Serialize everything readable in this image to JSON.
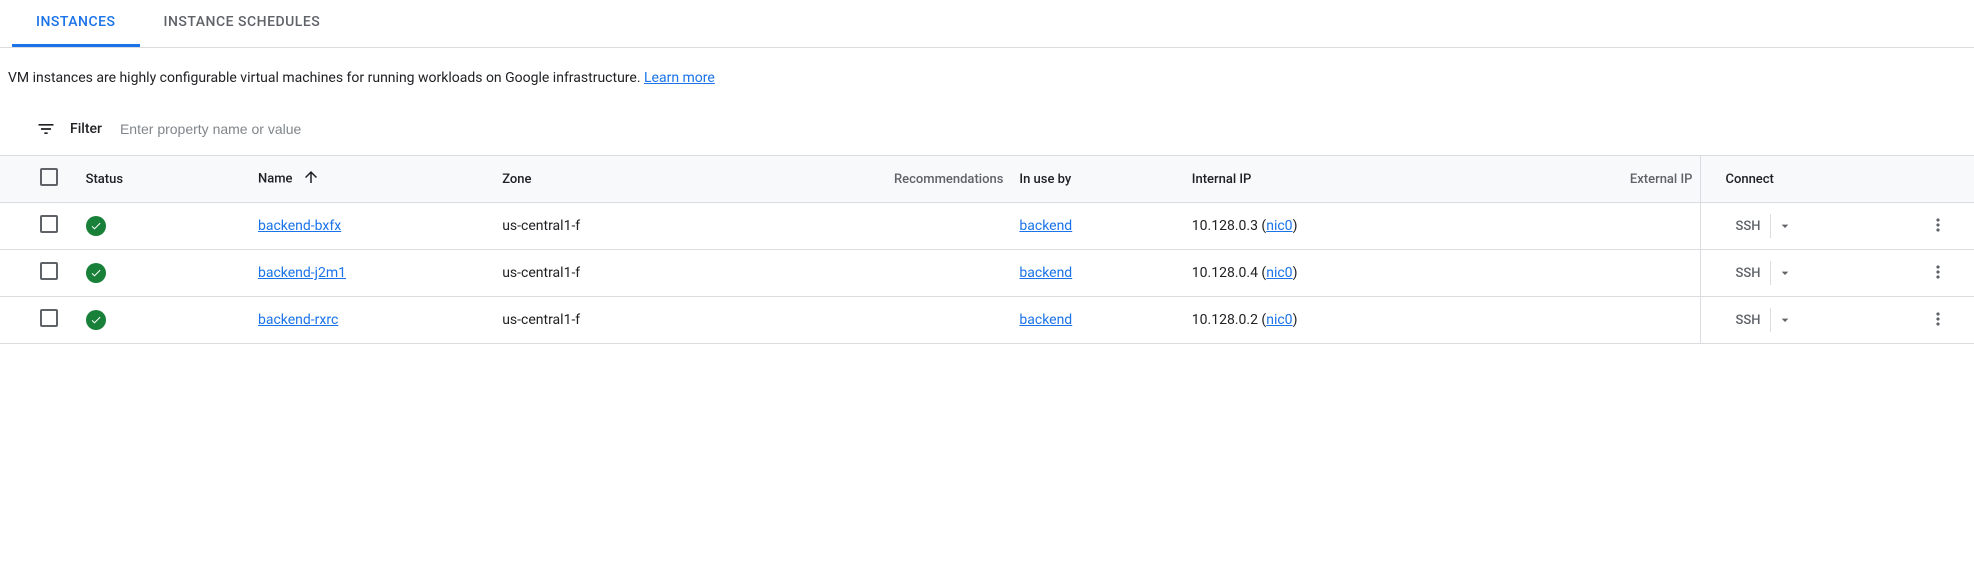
{
  "tabs": {
    "instances": "INSTANCES",
    "schedules": "INSTANCE SCHEDULES"
  },
  "description": {
    "text": "VM instances are highly configurable virtual machines for running workloads on Google infrastructure. ",
    "learn_more": "Learn more"
  },
  "filter": {
    "label": "Filter",
    "placeholder": "Enter property name or value"
  },
  "columns": {
    "status": "Status",
    "name": "Name",
    "zone": "Zone",
    "recommendations": "Recommendations",
    "in_use_by": "In use by",
    "internal_ip": "Internal IP",
    "external_ip": "External IP",
    "connect": "Connect"
  },
  "ssh_label": "SSH",
  "rows": [
    {
      "name": "backend-bxfx",
      "zone": "us-central1-f",
      "in_use_by": "backend",
      "internal_ip": "10.128.0.3",
      "nic": "nic0"
    },
    {
      "name": "backend-j2m1",
      "zone": "us-central1-f",
      "in_use_by": "backend",
      "internal_ip": "10.128.0.4",
      "nic": "nic0"
    },
    {
      "name": "backend-rxrc",
      "zone": "us-central1-f",
      "in_use_by": "backend",
      "internal_ip": "10.128.0.2",
      "nic": "nic0"
    }
  ]
}
